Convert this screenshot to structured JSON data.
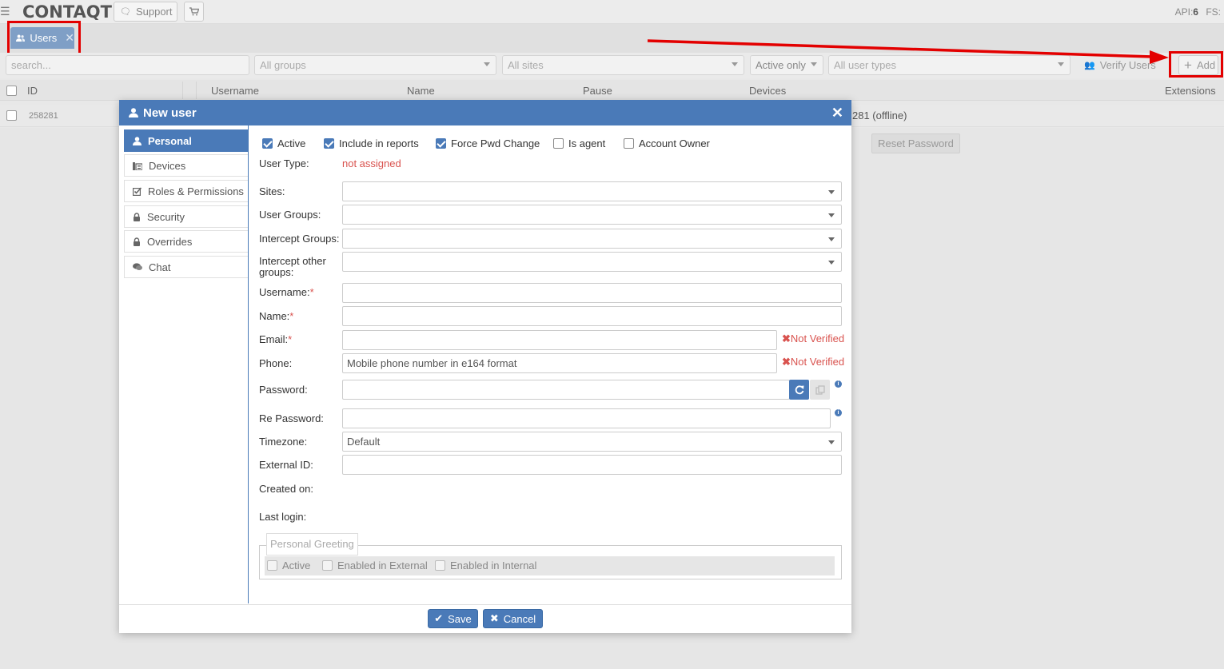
{
  "topbar": {
    "logo": "CONTAQT",
    "support_label": "Support",
    "api_label": "API:",
    "api_value": "6",
    "fs_label": "FS:"
  },
  "tabs": [
    {
      "label": "Users"
    }
  ],
  "filters": {
    "search_placeholder": "search...",
    "groups": "All groups",
    "sites": "All sites",
    "active": "Active only",
    "user_types": "All user types",
    "verify_label": "Verify Users",
    "add_label": "Add"
  },
  "grid": {
    "columns": [
      "ID",
      "Username",
      "Name",
      "Pause",
      "Devices",
      "Extensions"
    ],
    "rows": [
      {
        "id": "258281",
        "devices": "281 (offline)"
      }
    ]
  },
  "modal": {
    "title": "New user",
    "sidebar": [
      {
        "label": "Personal"
      },
      {
        "label": "Devices"
      },
      {
        "label": "Roles & Permissions"
      },
      {
        "label": "Security"
      },
      {
        "label": "Overrides"
      },
      {
        "label": "Chat"
      }
    ],
    "checkboxes": [
      {
        "label": "Active",
        "checked": true
      },
      {
        "label": "Include in reports",
        "checked": true
      },
      {
        "label": "Force Pwd Change",
        "checked": true
      },
      {
        "label": "Is agent",
        "checked": false
      },
      {
        "label": "Account Owner",
        "checked": false
      }
    ],
    "reset_password_label": "Reset Password",
    "user_type_label": "User Type:",
    "user_type_value": "not assigned",
    "fields": {
      "sites": "Sites:",
      "user_groups": "User Groups:",
      "intercept_groups": "Intercept Groups:",
      "intercept_other_1": "Intercept other",
      "intercept_other_2": "groups:",
      "username": "Username:",
      "name": "Name:",
      "email": "Email:",
      "phone": "Phone:",
      "password": "Password:",
      "re_password": "Re Password:",
      "timezone": "Timezone:",
      "external_id": "External ID:",
      "created_on": "Created on:",
      "last_login": "Last login:"
    },
    "required_mark": "*",
    "phone_placeholder": "Mobile phone number in e164 format",
    "timezone_value": "Default",
    "not_verified": "Not Verified",
    "greeting": {
      "legend": "Personal Greeting",
      "options": [
        "Active",
        "Enabled in External",
        "Enabled in Internal"
      ]
    },
    "save_label": "Save",
    "cancel_label": "Cancel"
  },
  "colors": {
    "primary": "#4a7ab8",
    "annotation": "#e30000",
    "error": "#d9534f"
  }
}
